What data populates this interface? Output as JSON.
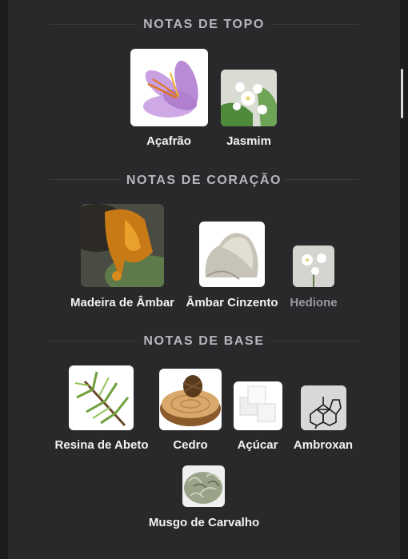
{
  "sections": {
    "top": {
      "title": "NOTAS DE TOPO",
      "items": [
        {
          "label": "Açafrão",
          "icon": "saffron-flower"
        },
        {
          "label": "Jasmim",
          "icon": "jasmine-flower"
        }
      ]
    },
    "heart": {
      "title": "NOTAS DE CORAÇÃO",
      "items": [
        {
          "label": "Madeira de Âmbar",
          "icon": "amber-resin"
        },
        {
          "label": "Âmbar Cinzento",
          "icon": "ambergris-stone"
        },
        {
          "label": "Hedione",
          "icon": "white-flower"
        }
      ]
    },
    "base": {
      "title": "NOTAS DE BASE",
      "items": [
        {
          "label": "Resina de Abeto",
          "icon": "fir-branch"
        },
        {
          "label": "Cedro",
          "icon": "cedar-log"
        },
        {
          "label": "Açúcar",
          "icon": "sugar-cubes"
        },
        {
          "label": "Ambroxan",
          "icon": "molecule-structure"
        },
        {
          "label": "Musgo de Carvalho",
          "icon": "oakmoss"
        }
      ]
    }
  },
  "colors": {
    "background": "#1c1c1e",
    "panel": "#29292b",
    "section_title": "#b7b7bb",
    "label": "#f2f2f2",
    "label_dim": "#9a9a9f"
  }
}
